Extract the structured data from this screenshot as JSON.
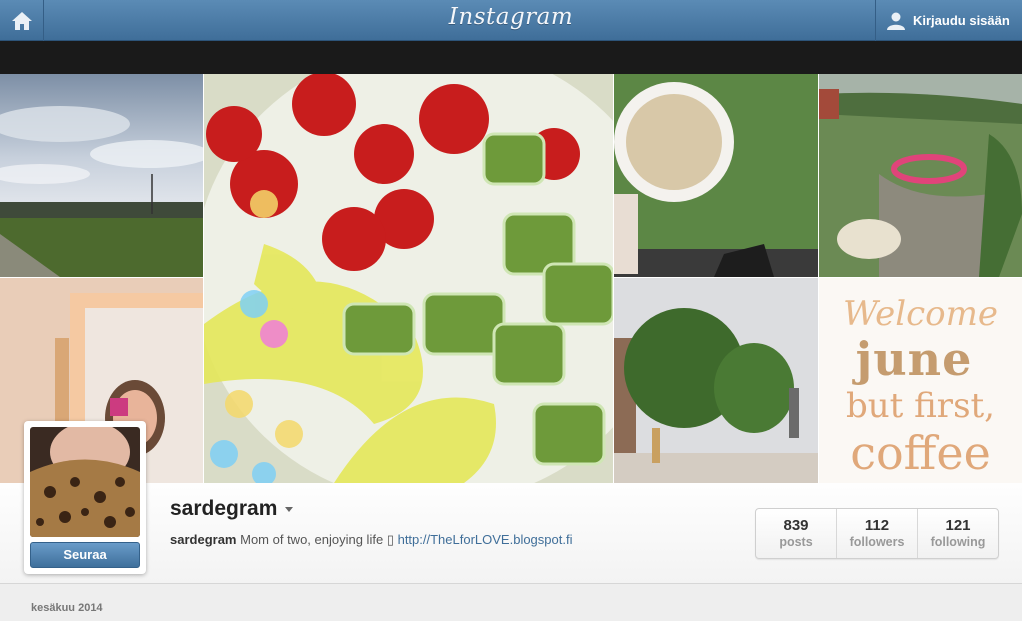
{
  "header": {
    "logo_text": "Instagram",
    "login_label": "Kirjaudu sisään"
  },
  "photos": [
    {
      "name": "cloudy-field"
    },
    {
      "name": "salad-bowl"
    },
    {
      "name": "coffee-cup-on-grass"
    },
    {
      "name": "amusement-park-aerial"
    },
    {
      "name": "mirror-selfie"
    },
    {
      "name": "park-statue-square"
    },
    {
      "name": "welcome-june-coffee-text",
      "text": {
        "line1": "Welcome",
        "line2": "june",
        "line3": "but first,",
        "line4": "coffee"
      }
    }
  ],
  "profile": {
    "username": "sardegram",
    "bio_name": "sardegram",
    "bio_text": "Mom of two, enjoying life",
    "bio_glyph": "▯",
    "bio_link": "http://TheLforLOVE.blogspot.fi",
    "follow_label": "Seuraa"
  },
  "stats": [
    {
      "value": "839",
      "label": "posts"
    },
    {
      "value": "112",
      "label": "followers"
    },
    {
      "value": "121",
      "label": "following"
    }
  ],
  "feed": {
    "month_label": "kesäkuu 2014"
  },
  "colors": {
    "header_blue": "#4a7aa6",
    "link_blue": "#3f6e99"
  }
}
